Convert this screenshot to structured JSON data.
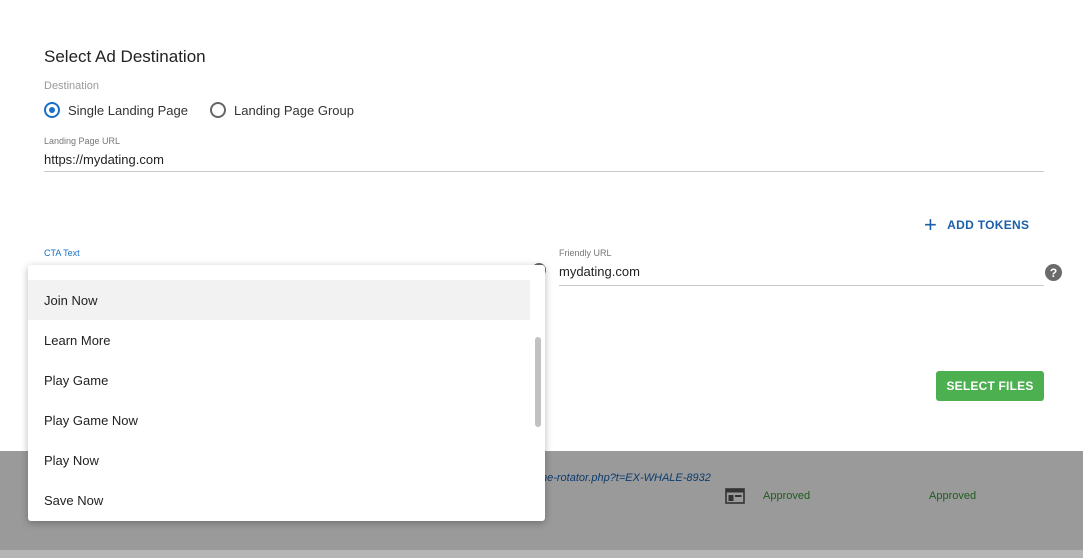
{
  "modal": {
    "title": "Select Ad Destination",
    "destination_label": "Destination",
    "destination_options": [
      {
        "label": "Single Landing Page",
        "selected": true
      },
      {
        "label": "Landing Page Group",
        "selected": false
      }
    ],
    "landing_page_url_label": "Landing Page URL",
    "landing_page_url_value": "https://mydating.com",
    "add_tokens_label": "ADD TOKENS",
    "cta_text_label": "CTA Text",
    "friendly_url_label": "Friendly URL",
    "friendly_url_value": "mydating.com",
    "help_icon_glyph": "?",
    "select_files_label": "SELECT FILES"
  },
  "cta_dropdown": {
    "items": [
      "Join Now",
      "Learn More",
      "Play Game",
      "Play Game Now",
      "Play Now",
      "Save Now"
    ],
    "hovered_index": 0
  },
  "background_table": {
    "link_text": "ne-rotator.php?t=EX-WHALE-8932",
    "creative_status": "Approved",
    "overall_status": "Approved"
  },
  "colors": {
    "accent_blue": "#1a6fc9",
    "token_blue": "#1b5fa8",
    "select_files_green": "#4caf50",
    "approved_green": "#1e5c1e"
  }
}
